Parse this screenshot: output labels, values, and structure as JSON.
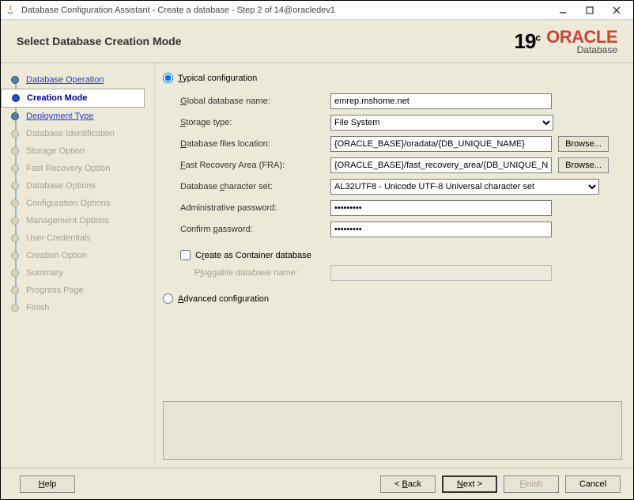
{
  "titlebar": {
    "title": "Database Configuration Assistant - Create a database - Step 2 of 14@oracledev1"
  },
  "header": {
    "title": "Select Database Creation Mode",
    "version": "19",
    "version_suffix": "c",
    "brand": "ORACLE",
    "product": "Database"
  },
  "sidebar": {
    "items": [
      {
        "label": "Database Operation",
        "state": "visited"
      },
      {
        "label": "Creation Mode",
        "state": "current"
      },
      {
        "label": "Deployment Type",
        "state": "visited"
      },
      {
        "label": "Database Identification",
        "state": "future"
      },
      {
        "label": "Storage Option",
        "state": "future"
      },
      {
        "label": "Fast Recovery Option",
        "state": "future"
      },
      {
        "label": "Database Options",
        "state": "future"
      },
      {
        "label": "Configuration Options",
        "state": "future"
      },
      {
        "label": "Management Options",
        "state": "future"
      },
      {
        "label": "User Credentials",
        "state": "future"
      },
      {
        "label": "Creation Option",
        "state": "future"
      },
      {
        "label": "Summary",
        "state": "future"
      },
      {
        "label": "Progress Page",
        "state": "future"
      },
      {
        "label": "Finish",
        "state": "future"
      }
    ]
  },
  "form": {
    "mode_typical_label": "Typical configuration",
    "mode_advanced_label": "Advanced configuration",
    "global_db_label": "Global database name:",
    "global_db_mn": "G",
    "global_db_value": "emrep.mshome.net",
    "storage_label": "Storage type:",
    "storage_mn": "S",
    "storage_value": "File System",
    "files_label": "Database files location:",
    "files_mn": "D",
    "files_value": "{ORACLE_BASE}/oradata/{DB_UNIQUE_NAME}",
    "fra_label": "Fast Recovery Area (FRA):",
    "fra_mn": "F",
    "fra_value": "{ORACLE_BASE}/fast_recovery_area/{DB_UNIQUE_NAME}",
    "charset_label": "Database character set:",
    "charset_mn": "c",
    "charset_value": "AL32UTF8 - Unicode UTF-8 Universal character set",
    "admin_pw_label": "Administrative password:",
    "admin_pw_value": "•••••••••",
    "confirm_pw_label": "Confirm password:",
    "confirm_pw_mn": "p",
    "confirm_pw_value": "•••••••••",
    "container_label": "Create as Container database",
    "container_mn": "r",
    "pluggable_label": "Pluggable database name:",
    "pluggable_mn": "l",
    "browse_label": "Browse..."
  },
  "footer": {
    "help": "Help",
    "back": "< Back",
    "next": "Next >",
    "finish": "Finish",
    "cancel": "Cancel"
  }
}
